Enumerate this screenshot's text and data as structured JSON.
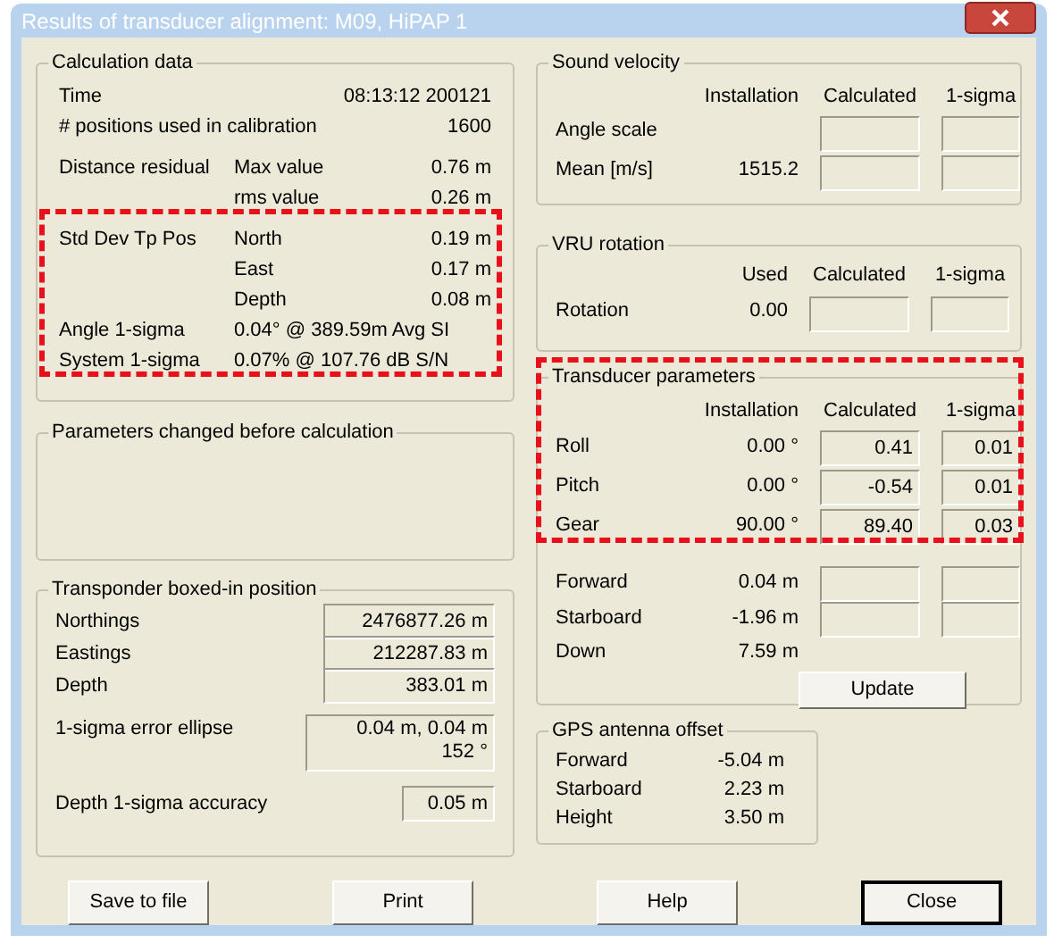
{
  "window": {
    "title": "Results of transducer alignment: M09, HiPAP 1"
  },
  "calculation_data": {
    "title": "Calculation data",
    "header_rows": [
      {
        "label": "Time",
        "value": "08:13:12 200121"
      },
      {
        "label": "# positions used in calibration",
        "value": "1600"
      }
    ],
    "distance_residual": {
      "label": "Distance residual",
      "rows": [
        {
          "label": "Max value",
          "value": "0.76 m"
        },
        {
          "label": "rms value",
          "value": "0.26 m"
        }
      ]
    },
    "highlight": {
      "highlighted": true,
      "std_dev": {
        "label": "Std Dev Tp Pos",
        "rows": [
          {
            "label": "North",
            "value": "0.19 m"
          },
          {
            "label": "East",
            "value": "0.17 m"
          },
          {
            "label": "Depth",
            "value": "0.08 m"
          }
        ]
      },
      "sigma_rows": [
        {
          "label": "Angle 1-sigma",
          "value": "0.04° @ 389.59m Avg SI"
        },
        {
          "label": "System 1-sigma",
          "value": "0.07% @ 107.76 dB S/N"
        }
      ]
    }
  },
  "parameters_changed": {
    "title": "Parameters changed before calculation"
  },
  "transponder_position": {
    "title": "Transponder boxed-in position",
    "rows": [
      {
        "label": "Northings",
        "value": "2476877.26 m"
      },
      {
        "label": "Eastings",
        "value": "212287.83 m"
      },
      {
        "label": "Depth",
        "value": "383.01 m"
      }
    ],
    "error_ellipse": {
      "label": "1-sigma error ellipse",
      "lines": [
        "0.04 m, 0.04 m",
        "152 °"
      ]
    },
    "depth_accuracy": {
      "label": "Depth 1-sigma accuracy",
      "value": "0.05 m"
    }
  },
  "sound_velocity": {
    "title": "Sound velocity",
    "columns": [
      "Installation",
      "Calculated",
      "1-sigma"
    ],
    "rows": [
      {
        "label": "Angle scale"
      },
      {
        "label": "Mean [m/s]",
        "installation": "1515.2"
      }
    ]
  },
  "vru_rotation": {
    "title": "VRU rotation",
    "columns": [
      "Used",
      "Calculated",
      "1-sigma"
    ],
    "rows": [
      {
        "label": "Rotation",
        "used": "0.00"
      }
    ]
  },
  "transducer_parameters": {
    "title": "Transducer parameters",
    "highlighted": true,
    "columns": [
      "Installation",
      "Calculated",
      "1-sigma"
    ],
    "rows": [
      {
        "label": "Roll",
        "installation": "0.00 °",
        "calculated": "0.41",
        "sigma": "0.01"
      },
      {
        "label": "Pitch",
        "installation": "0.00 °",
        "calculated": "-0.54",
        "sigma": "0.01"
      },
      {
        "label": "Gear",
        "installation": "90.00 °",
        "calculated": "89.40",
        "sigma": "0.03"
      }
    ],
    "offsets": [
      {
        "kind": "fields",
        "label": "Forward",
        "value": "0.04 m"
      },
      {
        "kind": "fields",
        "label": "Starboard",
        "value": "-1.96 m"
      },
      {
        "kind": "plain",
        "label": "Down",
        "value": "7.59 m"
      }
    ],
    "update_button": "Update"
  },
  "gps_antenna_offset": {
    "title": "GPS antenna offset",
    "rows": [
      {
        "label": "Forward",
        "value": "-5.04 m"
      },
      {
        "label": "Starboard",
        "value": "2.23 m"
      },
      {
        "label": "Height",
        "value": "3.50 m"
      }
    ]
  },
  "buttons": [
    {
      "label": "Save to file",
      "default": false
    },
    {
      "label": "Print",
      "default": false
    },
    {
      "label": "Help",
      "default": false
    },
    {
      "label": "Close",
      "default": true
    }
  ]
}
